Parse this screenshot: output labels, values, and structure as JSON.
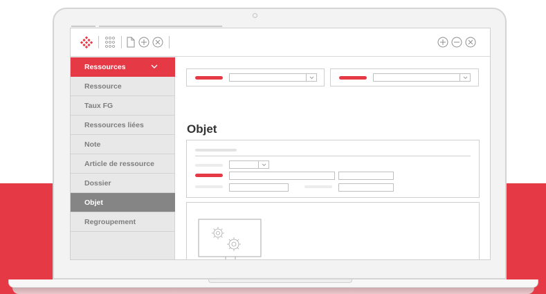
{
  "page": {
    "title": "Objet"
  },
  "sidebar": {
    "header": {
      "label": "Ressources"
    },
    "items": [
      {
        "label": "Ressource"
      },
      {
        "label": "Taux FG"
      },
      {
        "label": "Ressources liées"
      },
      {
        "label": "Note"
      },
      {
        "label": "Article de ressource"
      },
      {
        "label": "Dossier"
      },
      {
        "label": "Objet",
        "active": true
      },
      {
        "label": "Regroupement"
      }
    ]
  },
  "colors": {
    "accent": "#e63946",
    "sidebar_bg": "#e8e8e8",
    "active_item": "#858585"
  },
  "icons": [
    "logo-diamond-icon",
    "apps-grid-icon",
    "new-document-icon",
    "add-circle-icon",
    "close-circle-icon",
    "remove-circle-icon",
    "chevron-down-icon",
    "gears-monitor-icon"
  ]
}
